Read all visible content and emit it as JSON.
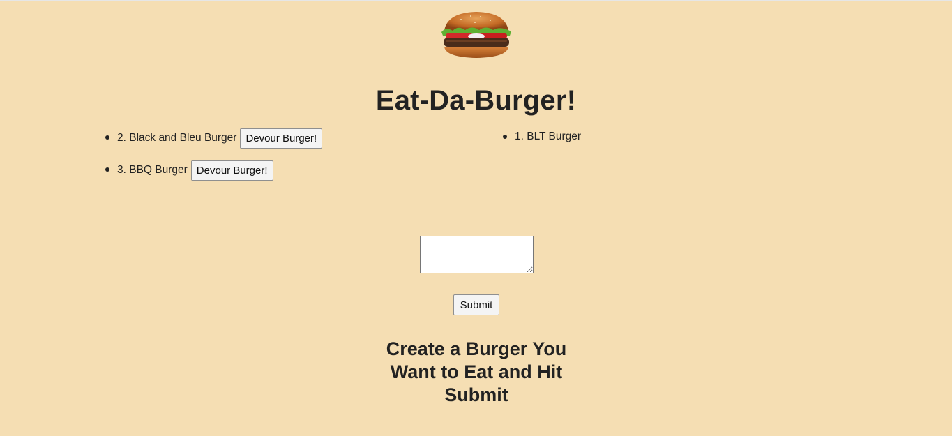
{
  "page": {
    "title": "Eat-Da-Burger!",
    "logo_icon": "burger-icon",
    "background_color": "#f5deb3"
  },
  "burgers_to_devour": [
    {
      "label": "2. Black and Bleu Burger",
      "button_label": "Devour Burger!"
    },
    {
      "label": "3. BBQ Burger",
      "button_label": "Devour Burger!"
    }
  ],
  "devoured_burgers": [
    {
      "label": "1. BLT Burger"
    }
  ],
  "form": {
    "input_value": "",
    "submit_label": "Submit",
    "instructions": "Create a Burger You Want to Eat and Hit Submit"
  }
}
